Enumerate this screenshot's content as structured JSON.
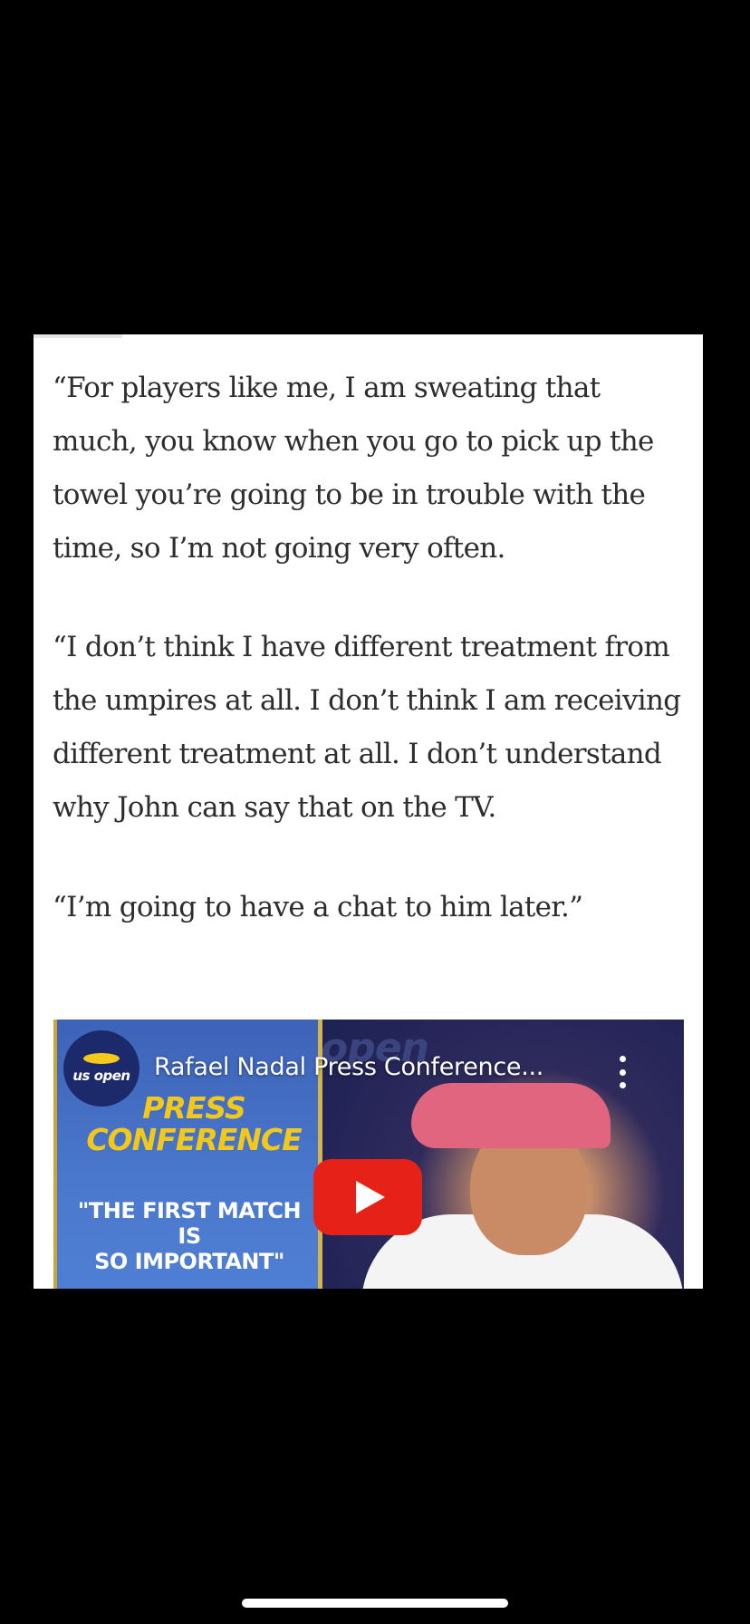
{
  "article": {
    "paragraphs": [
      "“For players like me, I am sweating that\nmuch, you know when you go to pick up the\ntowel you’re going to be in trouble with the\ntime, so I’m not going very often.",
      "“I don’t think I have different treatment from\nthe umpires at all. I don’t think I am receiving\ndifferent treatment at all. I don’t understand\nwhy John can say that on the TV.",
      "“I’m going to have a chat to him later.”"
    ]
  },
  "video": {
    "title": "Rafael Nadal Press Conference...",
    "channel_logo_text": "us open",
    "thumbnail_heading": "PRESS\nCONFERENCE",
    "thumbnail_quote": "\"THE FIRST MATCH IS\nSO IMPORTANT\"",
    "background_brand": "open",
    "play_icon": "play-icon",
    "menu_icon": "more-vert-icon"
  },
  "colors": {
    "background": "#000000",
    "card": "#ffffff",
    "text": "#2d2d2d",
    "play_button": "#e62117",
    "press_heading": "#f2c81c"
  }
}
